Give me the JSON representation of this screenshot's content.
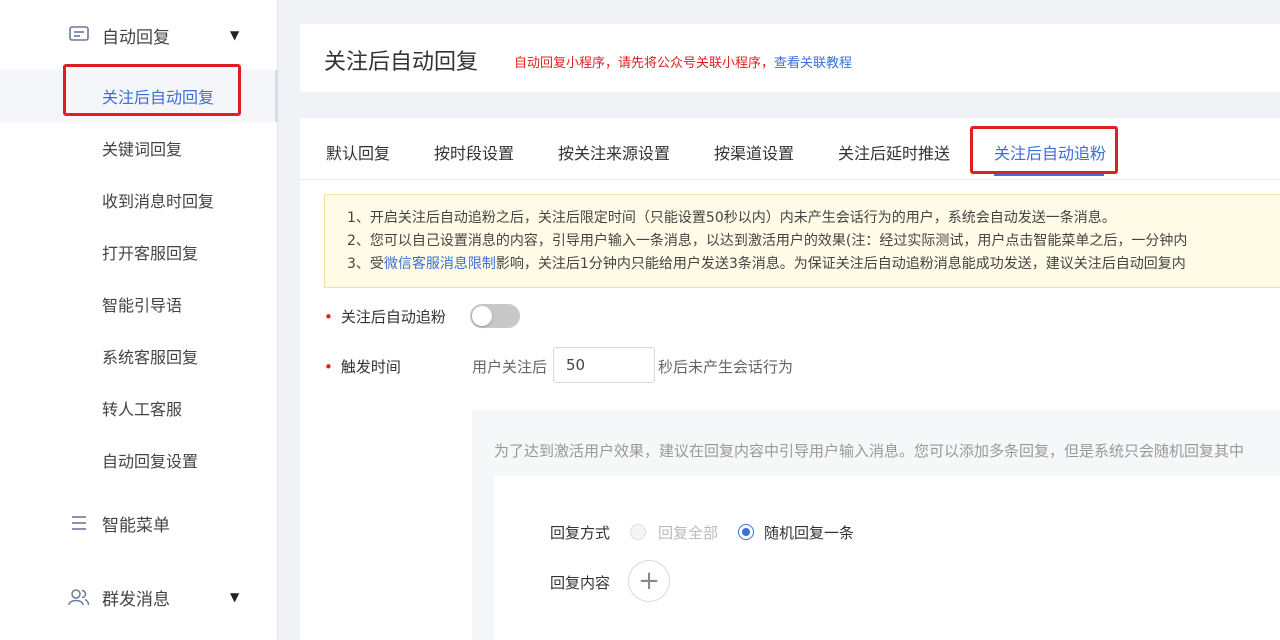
{
  "sidebar": {
    "group1": {
      "label": "自动回复",
      "icon": "message-square-icon"
    },
    "items": [
      {
        "label": "关注后自动回复",
        "active": true
      },
      {
        "label": "关键词回复"
      },
      {
        "label": "收到消息时回复"
      },
      {
        "label": "打开客服回复"
      },
      {
        "label": "智能引导语"
      },
      {
        "label": "系统客服回复"
      },
      {
        "label": "转人工客服"
      },
      {
        "label": "自动回复设置"
      }
    ],
    "group2": {
      "label": "智能菜单",
      "icon": "menu-list-icon"
    },
    "group3": {
      "label": "群发消息",
      "icon": "users-icon"
    }
  },
  "header": {
    "title": "关注后自动回复",
    "note": "自动回复小程序，请先将公众号关联小程序，",
    "note_link": "查看关联教程"
  },
  "tabs": [
    {
      "label": "默认回复"
    },
    {
      "label": "按时段设置"
    },
    {
      "label": "按关注来源设置"
    },
    {
      "label": "按渠道设置"
    },
    {
      "label": "关注后延时推送"
    },
    {
      "label": "关注后自动追粉",
      "active": true
    }
  ],
  "notice": {
    "line1": "1、开启关注后自动追粉之后，关注后限定时间（只能设置50秒以内）内未产生会话行为的用户，系统会自动发送一条消息。",
    "line2": "2、您可以自己设置消息的内容，引导用户输入一条消息，以达到激活用户的效果(注：经过实际测试，用户点击智能菜单之后，一分钟内",
    "line3_prefix": "3、受",
    "line3_link": "微信客服消息限制",
    "line3_suffix": "影响，关注后1分钟内只能给用户发送3条消息。为保证关注后自动追粉消息能成功发送，建议关注后自动回复内"
  },
  "form": {
    "auto_follow_label": "关注后自动追粉",
    "auto_follow_enabled": false,
    "trigger_label": "触发时间",
    "trigger_prefix": "用户关注后",
    "trigger_value": "50",
    "trigger_suffix": "秒后未产生会话行为"
  },
  "reply": {
    "hint": "为了达到激活用户效果，建议在回复内容中引导用户输入消息。您可以添加多条回复，但是系统只会随机回复其中",
    "method_label": "回复方式",
    "option_all": "回复全部",
    "option_random": "随机回复一条",
    "selected": "随机回复一条",
    "content_label": "回复内容",
    "add_icon": "plus-icon"
  },
  "colors": {
    "accent": "#3d6fd9",
    "highlight_box": "#e02020",
    "notice_bg": "#fffbe6"
  }
}
